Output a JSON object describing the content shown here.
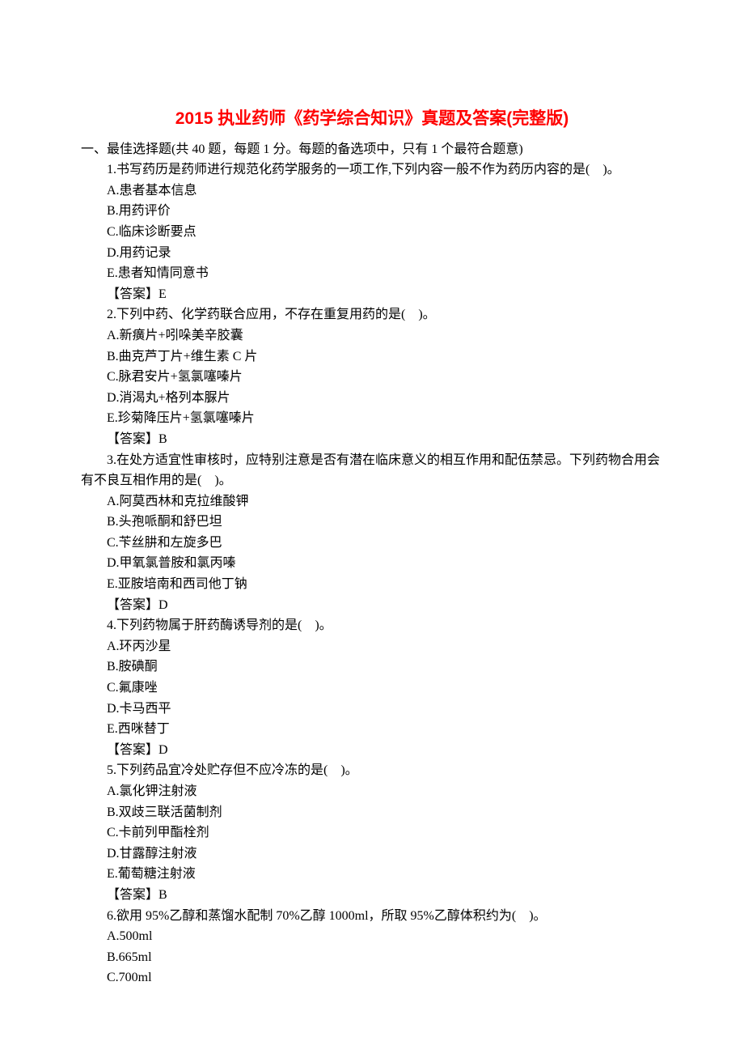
{
  "title": "2015 执业药师《药学综合知识》真题及答案(完整版)",
  "section_header": "一、最佳选择题(共 40 题，每题 1 分。每题的备选项中，只有 1 个最符合题意)",
  "questions": [
    {
      "stem": "1.书写药历是药师进行规范化药学服务的一项工作,下列内容一般不作为药历内容的是(　)。",
      "options": [
        "A.患者基本信息",
        "B.用药评价",
        "C.临床诊断要点",
        "D.用药记录",
        "E.患者知情同意书"
      ],
      "answer": "【答案】E"
    },
    {
      "stem": "2.下列中药、化学药联合应用，不存在重复用药的是(　)。",
      "options": [
        "A.新癀片+吲哚美辛胶囊",
        "B.曲克芦丁片+维生素 C 片",
        "C.脉君安片+氢氯噻嗪片",
        "D.消渴丸+格列本脲片",
        "E.珍菊降压片+氢氯噻嗪片"
      ],
      "answer": "【答案】B"
    },
    {
      "stem": "3.在处方适宜性审核时，应特别注意是否有潜在临床意义的相互作用和配伍禁忌。下列药物合用会有不良互相作用的是(　)。",
      "options": [
        "A.阿莫西林和克拉维酸钾",
        "B.头孢哌酮和舒巴坦",
        "C.苄丝肼和左旋多巴",
        "D.甲氧氯普胺和氯丙嗪",
        "E.亚胺培南和西司他丁钠"
      ],
      "answer": "【答案】D"
    },
    {
      "stem": "4.下列药物属于肝药酶诱导剂的是(　)。",
      "options": [
        "A.环丙沙星",
        "B.胺碘酮",
        "C.氟康唑",
        "D.卡马西平",
        "E.西咪替丁"
      ],
      "answer": "【答案】D"
    },
    {
      "stem": "5.下列药品宜冷处贮存但不应冷冻的是(　)。",
      "options": [
        "A.氯化钾注射液",
        "B.双歧三联活菌制剂",
        "C.卡前列甲酯栓剂",
        "D.甘露醇注射液",
        "E.葡萄糖注射液"
      ],
      "answer": "【答案】B"
    },
    {
      "stem": "6.欲用 95%乙醇和蒸馏水配制 70%乙醇 1000ml，所取 95%乙醇体积约为(　)。",
      "options": [
        "A.500ml",
        "B.665ml",
        "C.700ml"
      ],
      "answer": ""
    }
  ]
}
